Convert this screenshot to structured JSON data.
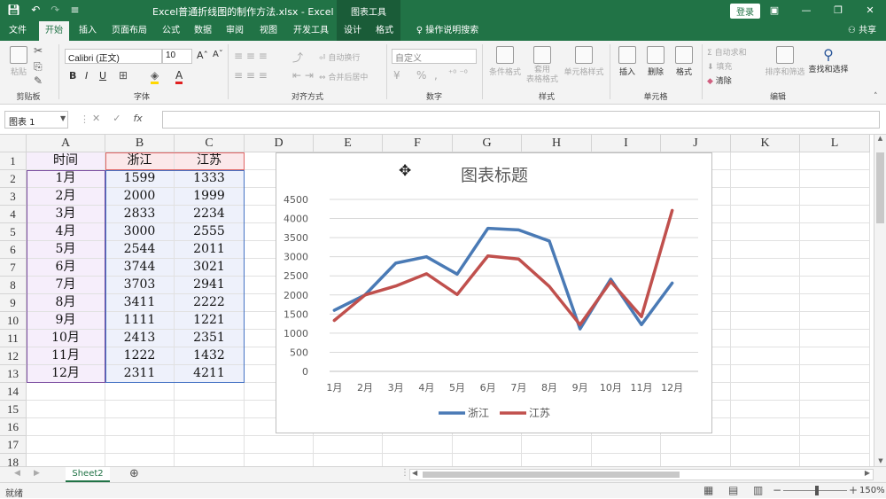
{
  "window": {
    "title": "Excel普通折线图的制作方法.xlsx  -  Excel",
    "context_tool": "图表工具",
    "login": "登录",
    "share": "共享",
    "tell_me": "操作说明搜索"
  },
  "tabs": [
    "文件",
    "开始",
    "插入",
    "页面布局",
    "公式",
    "数据",
    "审阅",
    "视图",
    "开发工具",
    "设计",
    "格式"
  ],
  "ribbon": {
    "clipboard": {
      "paste": "粘贴",
      "group": "剪贴板"
    },
    "font": {
      "name": "Calibri (正文)",
      "size": "10",
      "group": "字体",
      "bold": "B",
      "italic": "I",
      "underline": "U",
      "grow": "A",
      "shrink": "A"
    },
    "alignment": {
      "wrap": "自动换行",
      "merge": "合并后居中",
      "group": "对齐方式"
    },
    "number": {
      "format": "自定义",
      "group": "数字",
      "percent": "%",
      "comma": ","
    },
    "styles": {
      "conditional": "条件格式",
      "table": "套用\n表格格式",
      "cell_styles": "单元格样式",
      "group": "样式"
    },
    "cells": {
      "insert": "插入",
      "delete": "删除",
      "format": "格式",
      "group": "单元格"
    },
    "editing": {
      "autosum": "自动求和",
      "fill": "填充",
      "clear": "清除",
      "sort": "排序和筛选",
      "find": "查找和选择",
      "group": "编辑"
    }
  },
  "formula_bar": {
    "name_box": "图表 1",
    "cancel": "✕",
    "enter": "✓",
    "fx": "fx",
    "value": ""
  },
  "columns": [
    "A",
    "B",
    "C",
    "D",
    "E",
    "F",
    "G",
    "H",
    "I",
    "J",
    "K",
    "L"
  ],
  "rows": [
    "1",
    "2",
    "3",
    "4",
    "5",
    "6",
    "7",
    "8",
    "9",
    "10",
    "11",
    "12",
    "13",
    "14",
    "15",
    "16",
    "17",
    "18"
  ],
  "table": {
    "headers": [
      "时间",
      "浙江",
      "江苏"
    ],
    "rows": [
      [
        "1月",
        "1599",
        "1333"
      ],
      [
        "2月",
        "2000",
        "1999"
      ],
      [
        "3月",
        "2833",
        "2234"
      ],
      [
        "4月",
        "3000",
        "2555"
      ],
      [
        "5月",
        "2544",
        "2011"
      ],
      [
        "6月",
        "3744",
        "3021"
      ],
      [
        "7月",
        "3703",
        "2941"
      ],
      [
        "8月",
        "3411",
        "2222"
      ],
      [
        "9月",
        "1111",
        "1221"
      ],
      [
        "10月",
        "2413",
        "2351"
      ],
      [
        "11月",
        "1222",
        "1432"
      ],
      [
        "12月",
        "2311",
        "4211"
      ]
    ]
  },
  "chart_data": {
    "type": "line",
    "title": "图表标题",
    "categories": [
      "1月",
      "2月",
      "3月",
      "4月",
      "5月",
      "6月",
      "7月",
      "8月",
      "9月",
      "10月",
      "11月",
      "12月"
    ],
    "series": [
      {
        "name": "浙江",
        "color": "#4a7ab5",
        "values": [
          1599,
          2000,
          2833,
          3000,
          2544,
          3744,
          3703,
          3411,
          1111,
          2413,
          1222,
          2311
        ]
      },
      {
        "name": "江苏",
        "color": "#c0504d",
        "values": [
          1333,
          1999,
          2234,
          2555,
          2011,
          3021,
          2941,
          2222,
          1221,
          2351,
          1432,
          4211
        ]
      }
    ],
    "yticks": [
      "0",
      "500",
      "1000",
      "1500",
      "2000",
      "2500",
      "3000",
      "3500",
      "4000",
      "4500"
    ],
    "ylim": [
      0,
      4500
    ],
    "grid": true,
    "legend": "bottom"
  },
  "sheet": {
    "tab": "Sheet2",
    "add": "⊕"
  },
  "status": {
    "ready": "就绪",
    "zoom": "150%"
  },
  "colors": {
    "accent": "#217346",
    "range_a": "#7b4ea1",
    "range_b": "#6b5fb2",
    "range_c": "#4472c4",
    "header_red": "#e06666"
  }
}
